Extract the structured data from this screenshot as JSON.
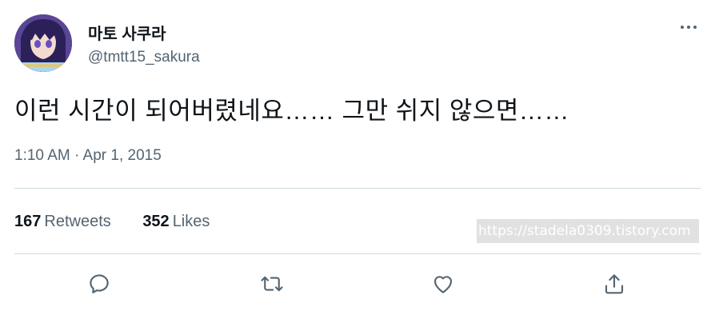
{
  "author": {
    "display_name": "마토 사쿠라",
    "handle": "@tmtt15_sakura",
    "avatar": "avatar-image"
  },
  "tweet": {
    "text": "이런 시간이 되어버렸네요…… 그만 쉬지 않으면……",
    "timestamp": "1:10 AM · Apr 1, 2015"
  },
  "stats": {
    "retweets_count": "167",
    "retweets_label": "Retweets",
    "likes_count": "352",
    "likes_label": "Likes"
  },
  "watermark": "https://stadela0309.tistory.com",
  "actions": {
    "reply": "reply-icon",
    "retweet": "retweet-icon",
    "like": "heart-icon",
    "share": "share-icon"
  },
  "colors": {
    "text_primary": "#0f1419",
    "text_secondary": "#536471",
    "divider": "#cfd9de"
  }
}
